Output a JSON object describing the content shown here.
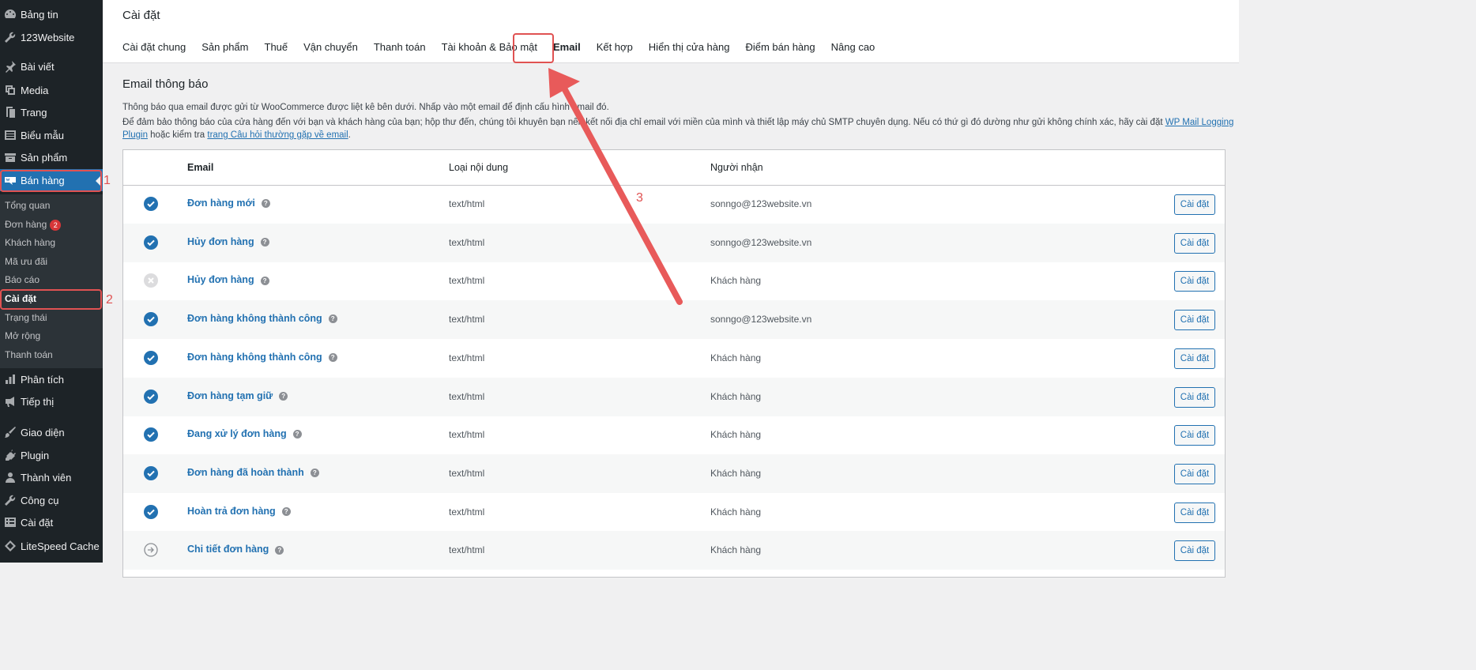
{
  "sidebar": {
    "top_items": [
      {
        "label": "Bảng tin",
        "icon": "dashboard-icon"
      },
      {
        "label": "123Website",
        "icon": "wrench-icon"
      },
      {
        "label": "Bài viết",
        "icon": "pin-icon"
      },
      {
        "label": "Media",
        "icon": "media-icon"
      },
      {
        "label": "Trang",
        "icon": "page-icon"
      },
      {
        "label": "Biểu mẫu",
        "icon": "form-icon"
      },
      {
        "label": "Sản phẩm",
        "icon": "archive-icon"
      },
      {
        "label": "Bán hàng",
        "icon": "woo-icon"
      }
    ],
    "submenu": [
      {
        "label": "Tổng quan"
      },
      {
        "label": "Đơn hàng",
        "badge": "2"
      },
      {
        "label": "Khách hàng"
      },
      {
        "label": "Mã ưu đãi"
      },
      {
        "label": "Báo cáo"
      },
      {
        "label": "Cài đặt"
      },
      {
        "label": "Trạng thái"
      },
      {
        "label": "Mở rộng"
      },
      {
        "label": "Thanh toán"
      }
    ],
    "bottom_items": [
      {
        "label": "Phân tích",
        "icon": "chart-icon"
      },
      {
        "label": "Tiếp thị",
        "icon": "megaphone-icon"
      },
      {
        "label": "Giao diện",
        "icon": "brush-icon"
      },
      {
        "label": "Plugin",
        "icon": "plugin-icon"
      },
      {
        "label": "Thành viên",
        "icon": "user-icon"
      },
      {
        "label": "Công cụ",
        "icon": "tool-icon"
      },
      {
        "label": "Cài đặt",
        "icon": "settings-icon"
      },
      {
        "label": "LiteSpeed Cache",
        "icon": "diamond-icon"
      }
    ]
  },
  "header": {
    "title": "Cài đặt",
    "tabs": [
      "Cài đặt chung",
      "Sản phẩm",
      "Thuế",
      "Vận chuyển",
      "Thanh toán",
      "Tài khoản & Bảo mật",
      "Email",
      "Kết hợp",
      "Hiển thị cửa hàng",
      "Điểm bán hàng",
      "Nâng cao"
    ],
    "active_tab": "Email"
  },
  "content": {
    "section_title": "Email thông báo",
    "desc1": "Thông báo qua email được gửi từ WooCommerce được liệt kê bên dưới. Nhấp vào một email để định cấu hình email đó.",
    "desc2_a": "Để đảm bảo thông báo của cửa hàng đến với bạn và khách hàng của bạn; hộp thư đến, chúng tôi khuyên bạn nên kết nối địa chỉ email với miền của mình và thiết lập máy chủ SMTP chuyên dụng. Nếu có thứ gì đó dường như gửi không chính xác, hãy cài đặt ",
    "desc2_link1": "WP Mail Logging Plugin",
    "desc2_b": " hoặc kiểm tra ",
    "desc2_link2": "trang Câu hỏi thường gặp về email",
    "desc2_c": ".",
    "table": {
      "headers": {
        "email": "Email",
        "content_type": "Loại nội dung",
        "recipient": "Người nhận"
      },
      "rows": [
        {
          "status": "enabled",
          "name": "Đơn hàng mới",
          "content_type": "text/html",
          "recipient": "sonngo@123website.vn",
          "action": "Cài đặt"
        },
        {
          "status": "enabled",
          "name": "Hủy đơn hàng",
          "content_type": "text/html",
          "recipient": "sonngo@123website.vn",
          "action": "Cài đặt"
        },
        {
          "status": "disabled",
          "name": "Hủy đơn hàng",
          "content_type": "text/html",
          "recipient": "Khách hàng",
          "action": "Cài đặt"
        },
        {
          "status": "enabled",
          "name": "Đơn hàng không thành công",
          "content_type": "text/html",
          "recipient": "sonngo@123website.vn",
          "action": "Cài đặt"
        },
        {
          "status": "enabled",
          "name": "Đơn hàng không thành công",
          "content_type": "text/html",
          "recipient": "Khách hàng",
          "action": "Cài đặt"
        },
        {
          "status": "enabled",
          "name": "Đơn hàng tạm giữ",
          "content_type": "text/html",
          "recipient": "Khách hàng",
          "action": "Cài đặt"
        },
        {
          "status": "enabled",
          "name": "Đang xử lý đơn hàng",
          "content_type": "text/html",
          "recipient": "Khách hàng",
          "action": "Cài đặt"
        },
        {
          "status": "enabled",
          "name": "Đơn hàng đã hoàn thành",
          "content_type": "text/html",
          "recipient": "Khách hàng",
          "action": "Cài đặt"
        },
        {
          "status": "enabled",
          "name": "Hoàn trả đơn hàng",
          "content_type": "text/html",
          "recipient": "Khách hàng",
          "action": "Cài đặt"
        },
        {
          "status": "manual",
          "name": "Chi tiết đơn hàng",
          "content_type": "text/html",
          "recipient": "Khách hàng",
          "action": "Cài đặt"
        }
      ]
    }
  },
  "annotations": {
    "n1": "1",
    "n2": "2",
    "n3": "3",
    "color": "#e05252"
  },
  "colors": {
    "sidebar_bg": "#1d2327",
    "accent": "#2271b1",
    "badge": "#d63638"
  }
}
